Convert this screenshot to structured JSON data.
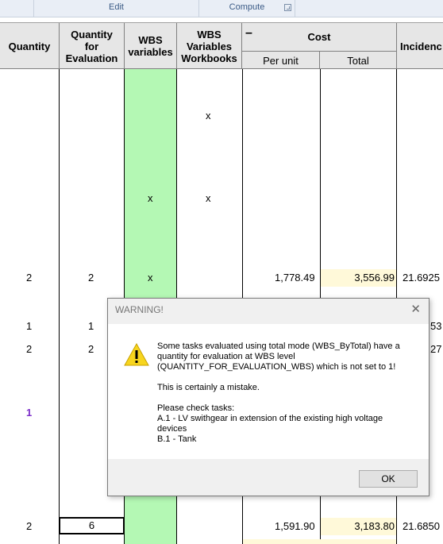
{
  "ribbon": {
    "groups": [
      "Edit",
      "Compute"
    ]
  },
  "headers": {
    "quantity": "Quantity",
    "quantity_for_evaluation": "Quantity for Evaluation",
    "wbs_variables": "WBS variables",
    "wbs_variables_workbooks": "WBS Variables Workbooks",
    "collapse_symbol": "–",
    "cost": "Cost",
    "per_unit": "Per unit",
    "total": "Total",
    "incidence": "Incidenc"
  },
  "rows": [
    {
      "quantity": "",
      "qty_eval": "",
      "wbs_var": "",
      "wbs_wb": "x",
      "per_unit": "",
      "total": "",
      "incidence": ""
    },
    {
      "quantity": "",
      "qty_eval": "",
      "wbs_var": "x",
      "wbs_wb": "x",
      "per_unit": "",
      "total": "",
      "incidence": ""
    },
    {
      "quantity": "2",
      "qty_eval": "2",
      "wbs_var": "x",
      "wbs_wb": "",
      "per_unit": "1,778.49",
      "total": "3,556.99",
      "incidence": "21.6925"
    },
    {
      "quantity": "1",
      "qty_eval": "1",
      "incidence": "53"
    },
    {
      "quantity": "2",
      "qty_eval": "2",
      "incidence": "27"
    },
    {
      "quantity": "1",
      "qty_eval": ""
    },
    {
      "quantity": "2",
      "qty_eval": "6",
      "per_unit": "1,591.90",
      "total": "3,183.80",
      "incidence": "21.6850"
    }
  ],
  "dialog": {
    "title": "WARNING!",
    "line1": "Some tasks evaluated using total mode (WBS_ByTotal) have a",
    "line2": "quantity for evaluation at WBS level",
    "line3": "(QUANTITY_FOR_EVALUATION_WBS) which is not set to 1!",
    "line4": "This is certainly a mistake.",
    "line5": "Please check tasks:",
    "line6": "A.1 - LV swithgear in extension of the existing high voltage",
    "line7": "devices",
    "line8": "B.1 - Tank",
    "ok_label": "OK",
    "close_symbol": "✕"
  },
  "colors": {
    "green_column": "#b4f8b4",
    "highlight_total": "#fff9d9",
    "purple_value": "#7b2cc9"
  }
}
